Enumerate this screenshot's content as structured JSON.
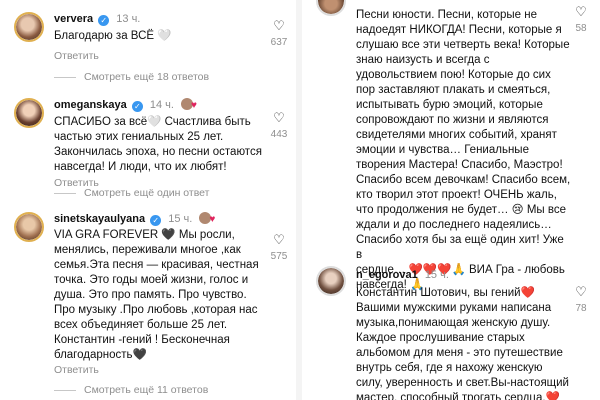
{
  "left_panel": {
    "comments": [
      {
        "username": "ververa",
        "verified": true,
        "time": "13 ч.",
        "text": "Благодарю за ВСЁ 🤍",
        "reply_label": "Ответить",
        "likes": "637",
        "more_replies": "Смотреть ещё 18 ответов"
      },
      {
        "username": "omeganskaya",
        "verified": true,
        "time": "14 ч.",
        "text": "СПАСИБО за всё🤍 Счастлива быть\nчастью этих гениальных 25 лет.\nЗакончилась эпоха, но песни остаются\nнавсегда! И люди, что их любят!",
        "reply_label": "Ответить",
        "likes": "443",
        "more_replies": "Смотреть ещё один ответ"
      },
      {
        "username": "sinetskayaulyana",
        "verified": true,
        "time": "15 ч.",
        "text": "VIA GRA FOREVER 🖤 Мы росли,\nменялись, переживали многое ,как\nсемья.Эта песня — красивая, честная\nточка. Это годы моей жизни, голос и\nдуша. Это про память. Про чувство.\nПро музыку .Про любовь ,которая нас\nвсех объединяет больше 25 лет.\nКонстантин -гений ! Бесконечная\nблагодарность🖤",
        "reply_label": "Ответить",
        "likes": "575",
        "more_replies": "Смотреть ещё 11 ответов"
      }
    ]
  },
  "right_panel": {
    "comments": [
      {
        "username": "",
        "time": "",
        "text": "Песни юности. Песни, которые не\nнадоедят НИКОГДА! Песни, которые я\nслушаю все эти четверть века! Которые\nзнаю наизусть и всегда с\nудовольствием пою! Которые до сих\nпор заставляют плакать и смеяться,\nиспытывать бурю эмоций, которые\nсопровождают по жизни и являются\nсвидетелями многих событий, хранят\nэмоции и чувства… Гениальные\nтворения Мастера! Спасибо, Маэстро!\nСпасибо всем девочкам! Спасибо всем,\nкто творил этот проект! ОЧЕНЬ жаль,\nчто продолжения не будет… 😢 Мы все\nждали и до последнего надеялись…\nСпасибо хотя бы за ещё один хит! Уже в\nсердце… ❤️❤️❤️🙏 ВИА Гра - любовь\nнавсегда! 🙏",
        "likes": "58"
      },
      {
        "username": "n_egorova1",
        "time": "15 ч.",
        "text": "Константин Шотович, вы гений❤️\nВашими мужскими руками написана\nмузыка,понимающая женскую душу.\nКаждое прослушивание старых\nальбомом  для меня - это путешествие\nвнутрь себя, где я нахожу женскую\nсилу, уверенность и свет.Вы-настоящий\nмастер, способный трогать сердца.❤️",
        "likes": "78"
      }
    ]
  },
  "icons": {
    "like": "heart-outline-icon",
    "verified": "verified-badge-icon"
  },
  "colors": {
    "verified": "#3897f0",
    "secondary_text": "#8e8e8e",
    "heart": "#e0245e"
  }
}
